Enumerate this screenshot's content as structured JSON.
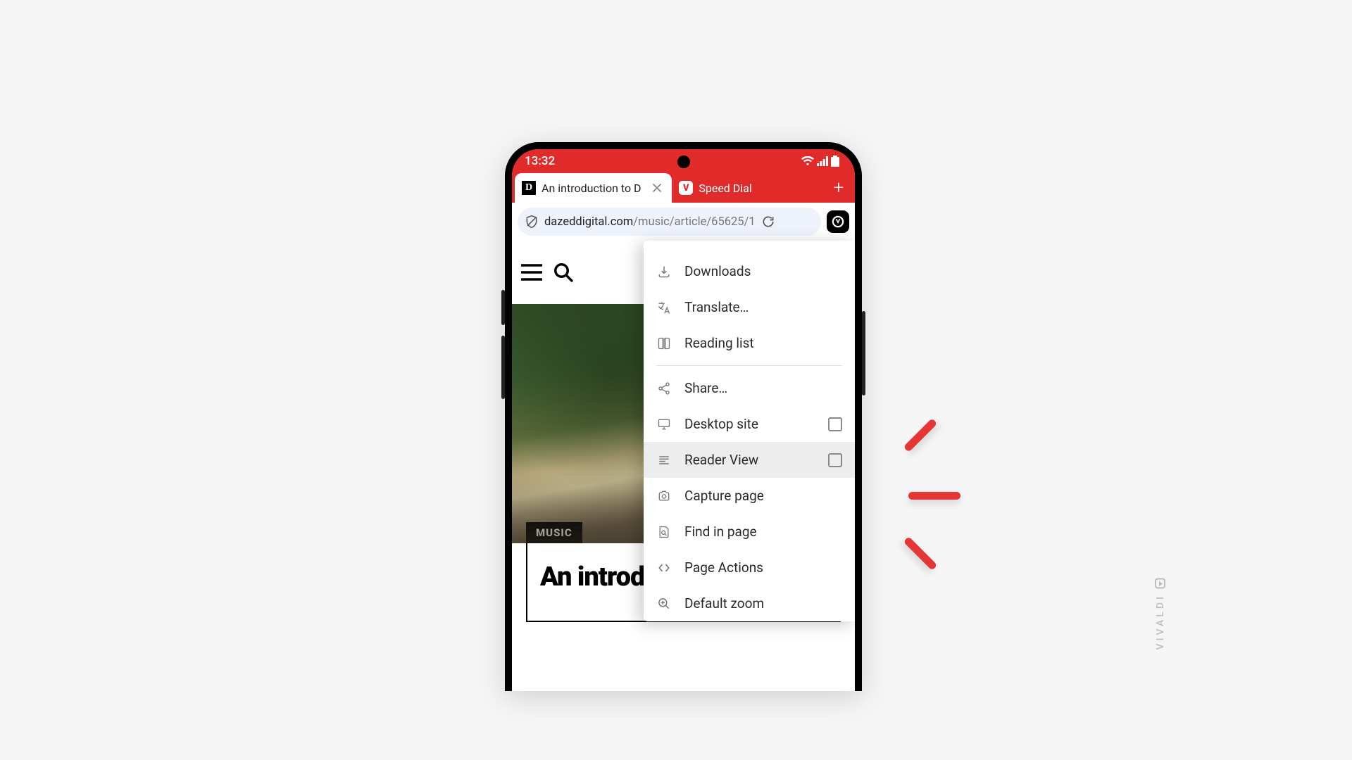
{
  "statusbar": {
    "time": "13:32"
  },
  "tabs": {
    "active": {
      "title": "An introduction to D"
    },
    "inactive": {
      "title": "Speed Dial"
    }
  },
  "address": {
    "host": "dazeddigital.com",
    "path": "/music/article/65625/1"
  },
  "page": {
    "category": "MUSIC",
    "headline": "An introd"
  },
  "menu": {
    "downloads": "Downloads",
    "translate": "Translate…",
    "reading_list": "Reading list",
    "share": "Share…",
    "desktop_site": "Desktop site",
    "reader_view": "Reader View",
    "capture_page": "Capture page",
    "find_in_page": "Find in page",
    "page_actions": "Page Actions",
    "default_zoom": "Default zoom"
  },
  "watermark": "VIVALDI"
}
